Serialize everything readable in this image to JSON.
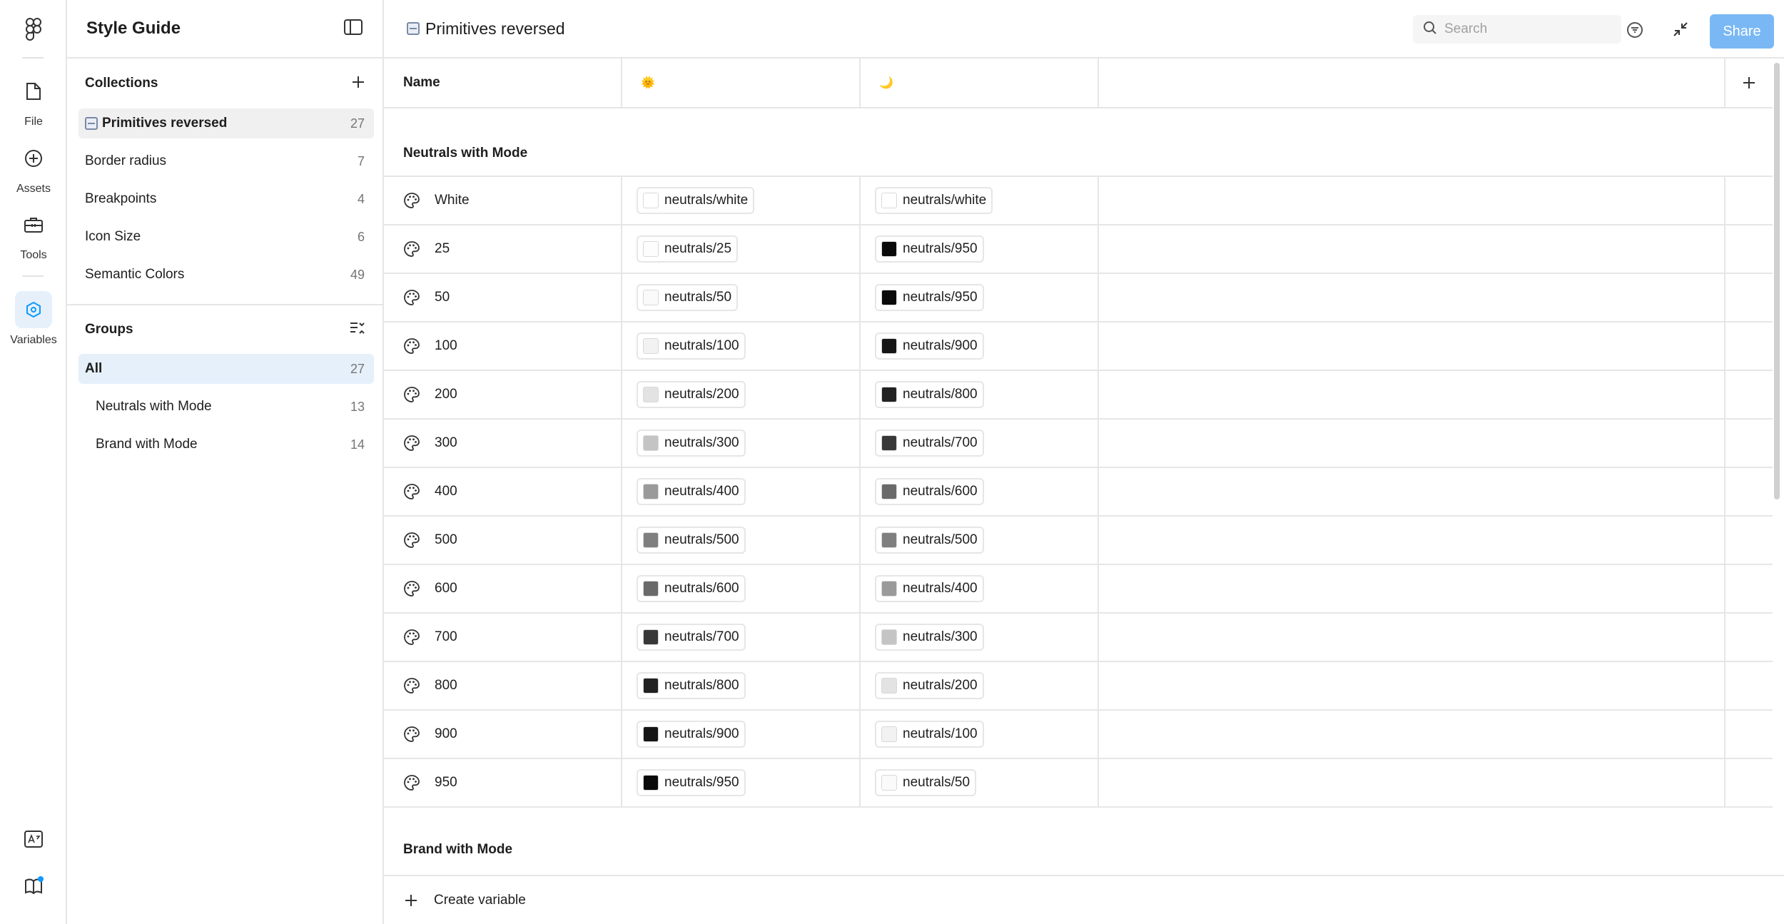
{
  "rail": {
    "items": [
      {
        "label": "File",
        "icon": "file-icon"
      },
      {
        "label": "Assets",
        "icon": "plus-circle-icon"
      },
      {
        "label": "Tools",
        "icon": "toolbox-icon"
      },
      {
        "label": "Variables",
        "icon": "variables-icon"
      }
    ]
  },
  "panel": {
    "title": "Style Guide",
    "collections_title": "Collections",
    "collections": [
      {
        "label": "Primitives reversed",
        "count": "27"
      },
      {
        "label": "Border radius",
        "count": "7"
      },
      {
        "label": "Breakpoints",
        "count": "4"
      },
      {
        "label": "Icon Size",
        "count": "6"
      },
      {
        "label": "Semantic Colors",
        "count": "49"
      }
    ],
    "groups_title": "Groups",
    "groups": [
      {
        "label": "All",
        "count": "27"
      },
      {
        "label": "Neutrals with Mode",
        "count": "13"
      },
      {
        "label": "Brand with Mode",
        "count": "14"
      }
    ]
  },
  "topbar": {
    "title": "Primitives reversed",
    "search_placeholder": "Search",
    "share_label": "Share"
  },
  "table": {
    "name_header": "Name",
    "mode1_emoji": "🌞",
    "mode2_emoji": "🌙",
    "group1_title": "Neutrals with Mode",
    "group2_title": "Brand with Mode",
    "rows": [
      {
        "name": "White",
        "m1": "neutrals/white",
        "m1_color": "#ffffff",
        "m2": "neutrals/white",
        "m2_color": "#ffffff"
      },
      {
        "name": "25",
        "m1": "neutrals/25",
        "m1_color": "#fdfdfd",
        "m2": "neutrals/950",
        "m2_color": "#0a0a0a"
      },
      {
        "name": "50",
        "m1": "neutrals/50",
        "m1_color": "#fafafa",
        "m2": "neutrals/950",
        "m2_color": "#0a0a0a"
      },
      {
        "name": "100",
        "m1": "neutrals/100",
        "m1_color": "#f2f2f2",
        "m2": "neutrals/900",
        "m2_color": "#161616"
      },
      {
        "name": "200",
        "m1": "neutrals/200",
        "m1_color": "#e3e3e3",
        "m2": "neutrals/800",
        "m2_color": "#222222"
      },
      {
        "name": "300",
        "m1": "neutrals/300",
        "m1_color": "#c4c4c4",
        "m2": "neutrals/700",
        "m2_color": "#383838"
      },
      {
        "name": "400",
        "m1": "neutrals/400",
        "m1_color": "#9a9a9a",
        "m2": "neutrals/600",
        "m2_color": "#6a6a6a"
      },
      {
        "name": "500",
        "m1": "neutrals/500",
        "m1_color": "#7f7f7f",
        "m2": "neutrals/500",
        "m2_color": "#7f7f7f"
      },
      {
        "name": "600",
        "m1": "neutrals/600",
        "m1_color": "#6a6a6a",
        "m2": "neutrals/400",
        "m2_color": "#9a9a9a"
      },
      {
        "name": "700",
        "m1": "neutrals/700",
        "m1_color": "#383838",
        "m2": "neutrals/300",
        "m2_color": "#c4c4c4"
      },
      {
        "name": "800",
        "m1": "neutrals/800",
        "m1_color": "#222222",
        "m2": "neutrals/200",
        "m2_color": "#e3e3e3"
      },
      {
        "name": "900",
        "m1": "neutrals/900",
        "m1_color": "#161616",
        "m2": "neutrals/100",
        "m2_color": "#f2f2f2"
      },
      {
        "name": "950",
        "m1": "neutrals/950",
        "m1_color": "#0a0a0a",
        "m2": "neutrals/50",
        "m2_color": "#fafafa"
      }
    ]
  },
  "footer": {
    "create_label": "Create variable"
  },
  "help_label": "?",
  "colors": {
    "accent": "#0d99ff",
    "share_bg": "#7ab8f5",
    "selected_bg": "#e5f0fb"
  }
}
